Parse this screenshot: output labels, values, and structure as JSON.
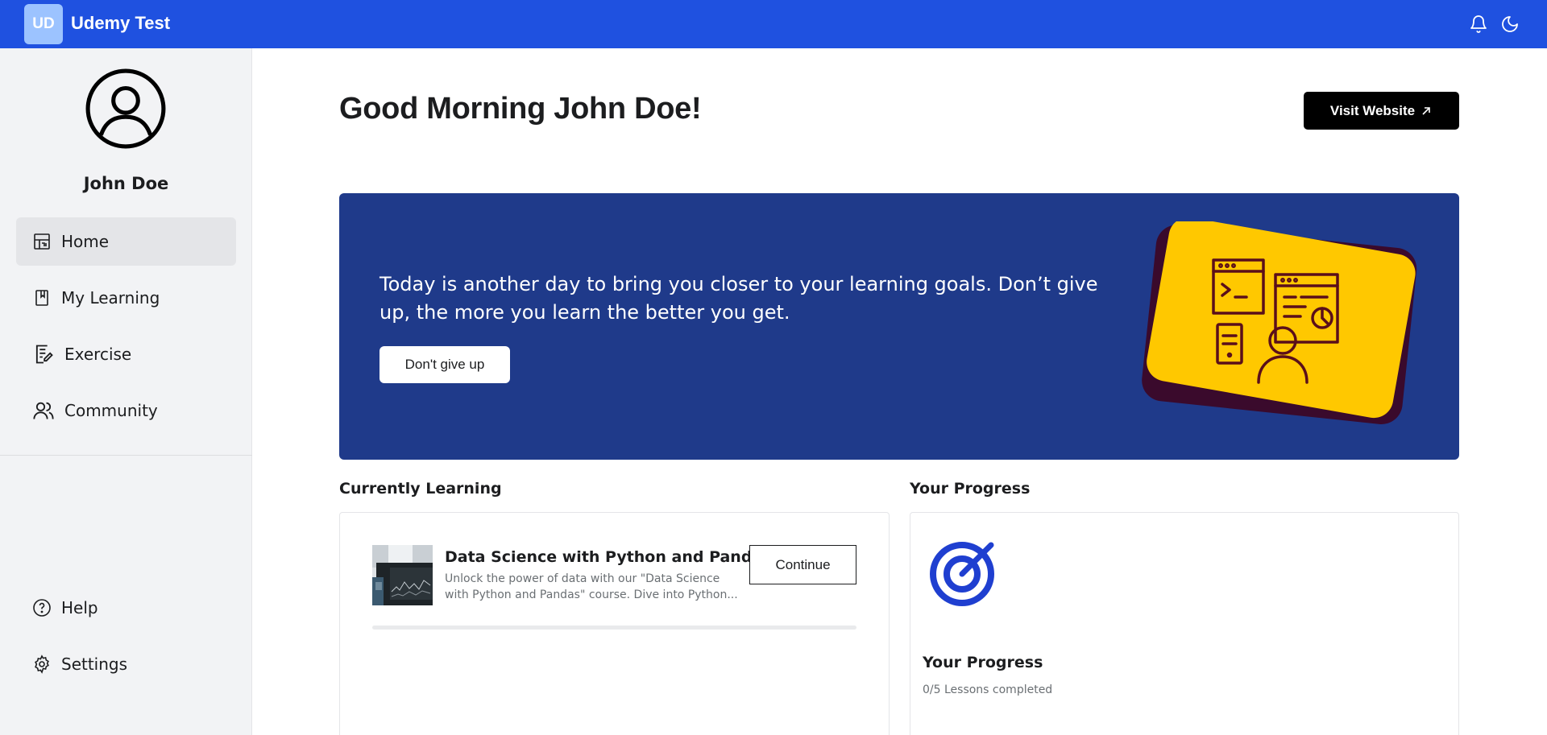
{
  "app": {
    "badge": "UD",
    "name": "Udemy Test",
    "brand_color": "#1f51e0"
  },
  "header_icons": {
    "notifications": "bell-icon",
    "theme": "moon-icon"
  },
  "sidebar": {
    "user_name": "John Doe",
    "nav": [
      {
        "label": "Home",
        "icon": "home-icon",
        "active": true
      },
      {
        "label": "My Learning",
        "icon": "bookmark-icon",
        "active": false
      },
      {
        "label": "Exercise",
        "icon": "edit-document-icon",
        "active": false
      },
      {
        "label": "Community",
        "icon": "users-icon",
        "active": false
      }
    ],
    "bottom": [
      {
        "label": "Help",
        "icon": "help-circle-icon"
      },
      {
        "label": "Settings",
        "icon": "gear-icon"
      }
    ]
  },
  "main": {
    "greeting": "Good Morning John Doe!",
    "visit_website": "Visit Website",
    "hero": {
      "text": "Today is another day to bring you closer to your learning goals. Don’t give up, the more you learn the better you get.",
      "button": "Don't give up",
      "bg_color": "#1f3a8a",
      "art_color": "#ffc800"
    },
    "currently_learning": {
      "title": "Currently Learning",
      "course": {
        "title": "Data Science with Python and Pandas",
        "description": "Unlock the power of data with our \"Data Science with Python and Pandas\" course. Dive into Python...",
        "button": "Continue",
        "progress": 0
      }
    },
    "your_progress": {
      "title": "Your Progress",
      "card_title": "Your Progress",
      "lessons_text": "0/5 Lessons completed",
      "icon": "target-icon"
    }
  }
}
